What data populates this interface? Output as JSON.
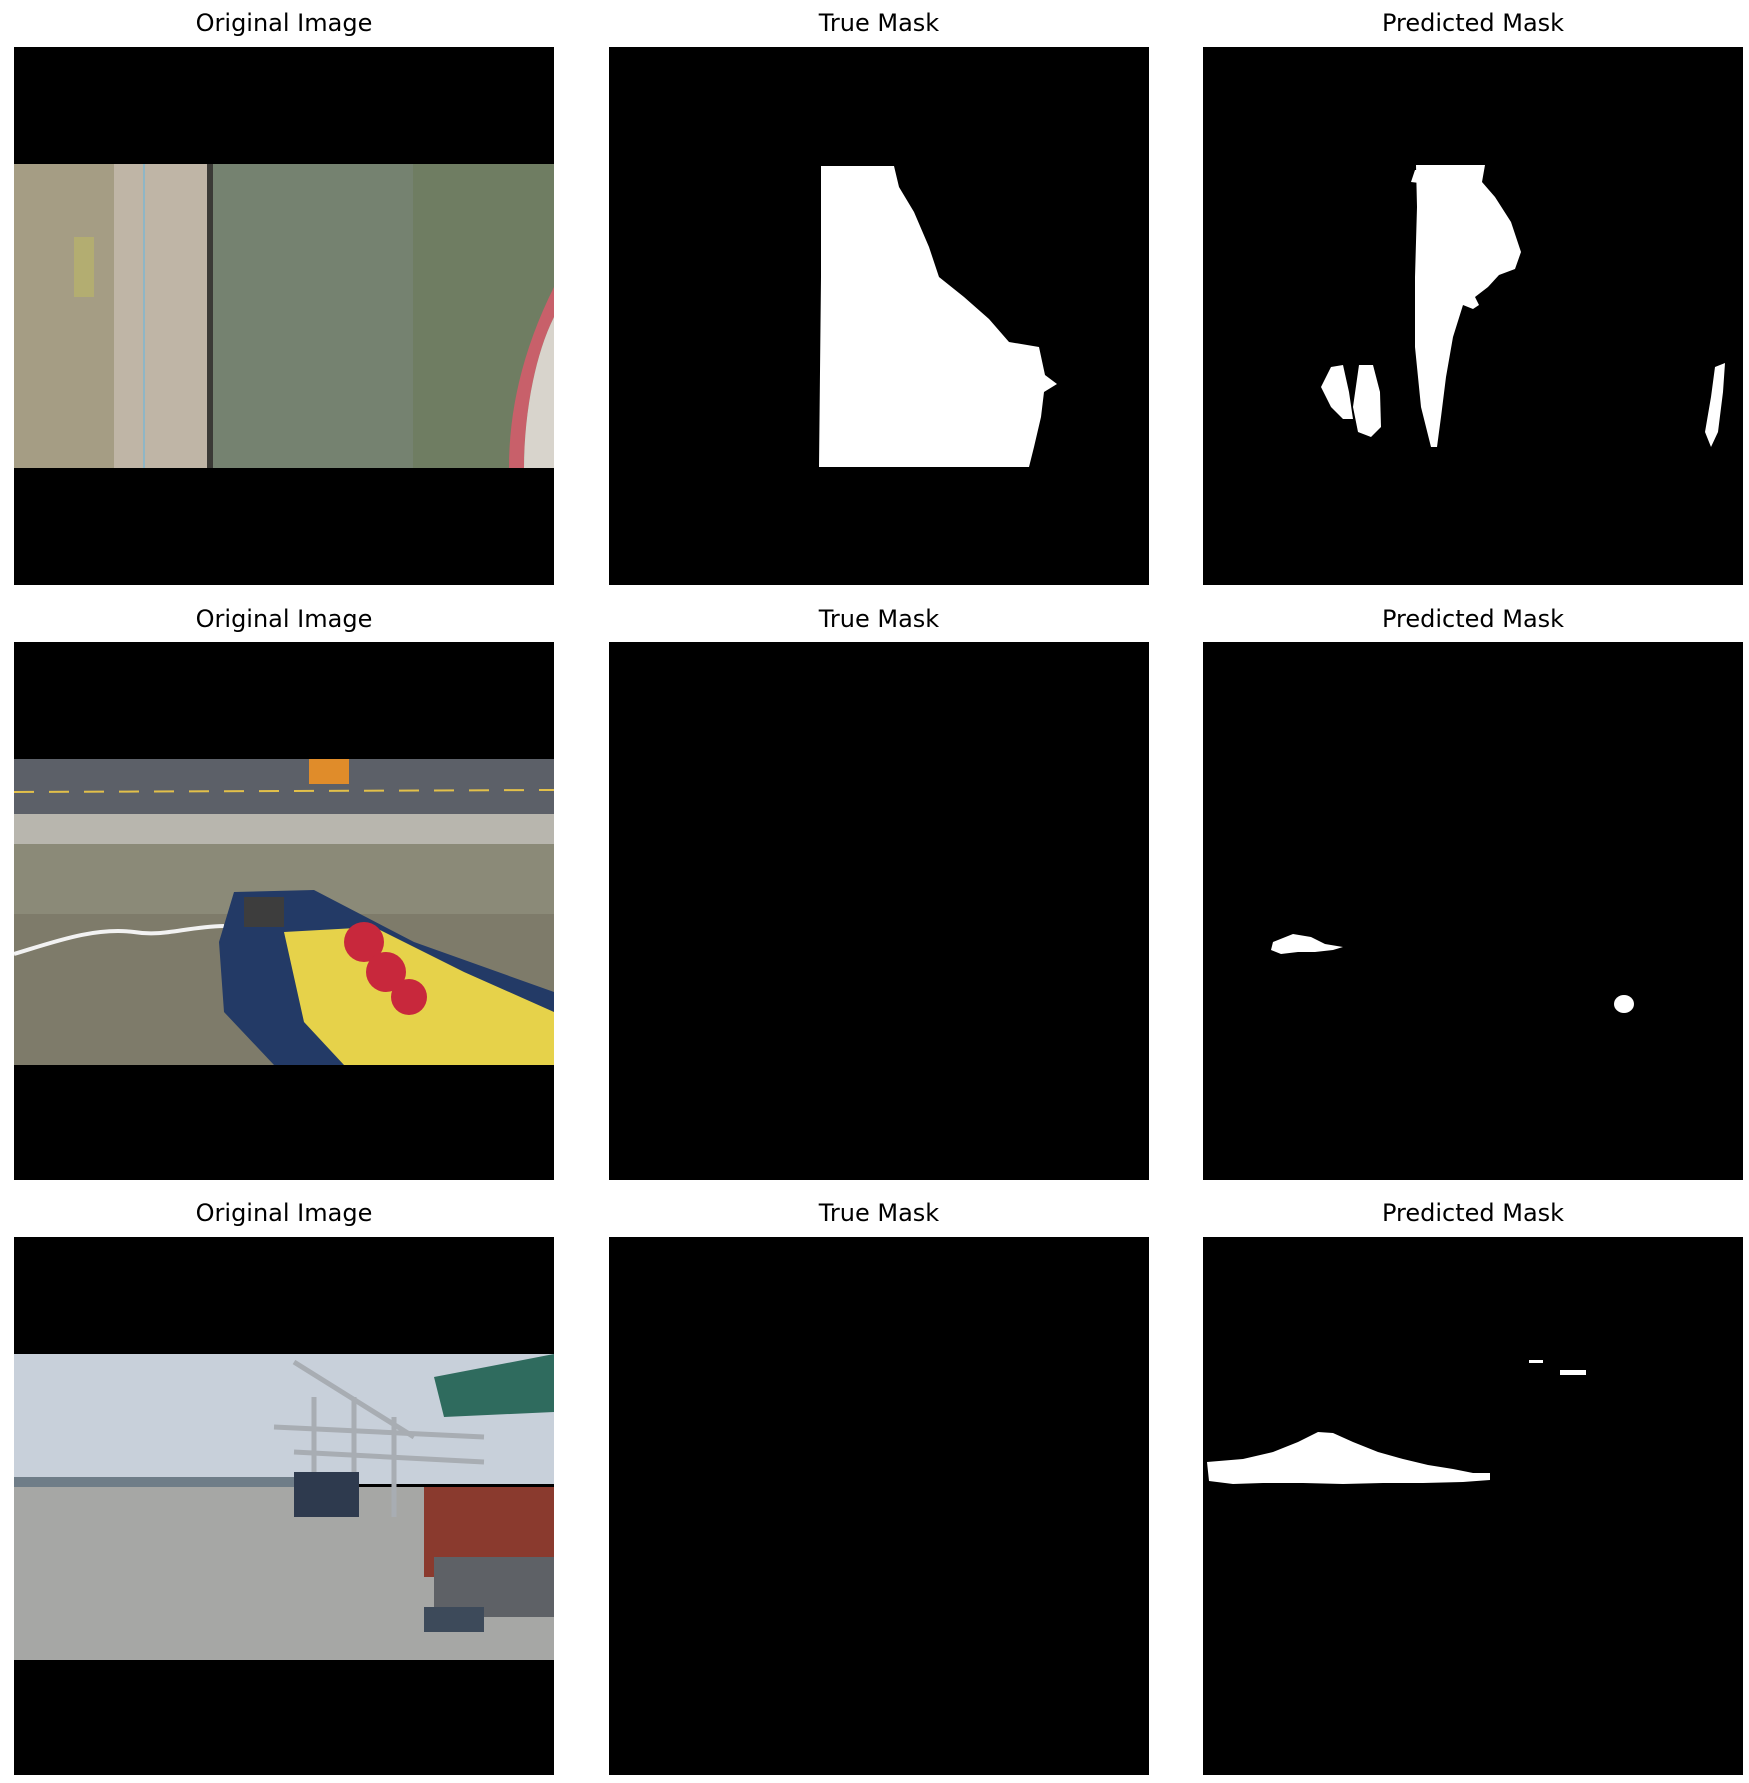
{
  "figure": {
    "rows": [
      {
        "original_title": "Original Image",
        "true_title": "True Mask",
        "pred_title": "Predicted Mask"
      },
      {
        "original_title": "Original Image",
        "true_title": "True Mask",
        "pred_title": "Predicted Mask"
      },
      {
        "original_title": "Original Image",
        "true_title": "True Mask",
        "pred_title": "Predicted Mask"
      }
    ]
  },
  "colors": {
    "background": "#000000",
    "mask": "#ffffff",
    "water_green": "#6f7d62",
    "quay_concrete": "#bfb5a6",
    "grass": "#a59d84",
    "hull_red": "#c8606a",
    "harbor_water": "#7e7b6a",
    "tug_blue": "#233a66",
    "drum_red": "#c8283c",
    "cargo_yellow": "#e6d24a",
    "sky": "#c8d0da",
    "crane_gray": "#a8adb3",
    "crane_green": "#2f6b5e",
    "container_red": "#8a3a2e"
  },
  "scenes": [
    "aerial-quay-water",
    "tugboat-at-quay",
    "container-port-cranes"
  ]
}
